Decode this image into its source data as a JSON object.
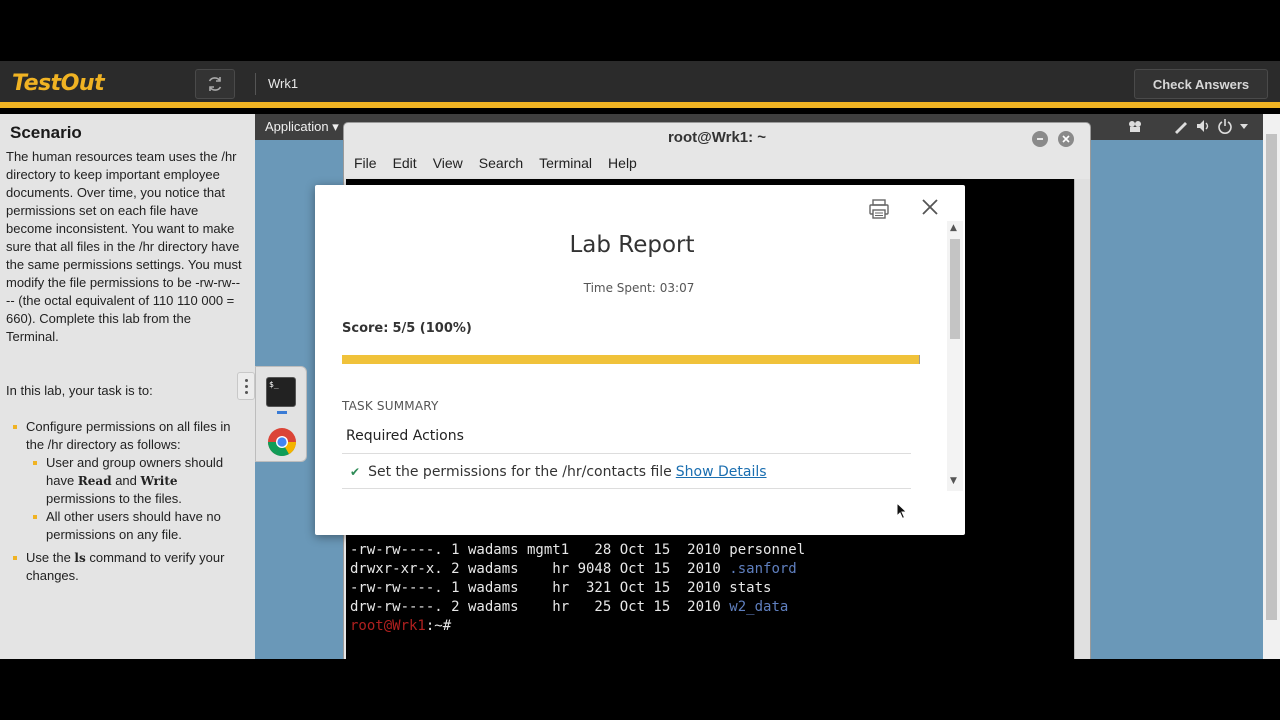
{
  "app": {
    "logo": "TestOut",
    "machine": "Wrk1",
    "check_answers": "Check Answers"
  },
  "scenario": {
    "title": "Scenario",
    "paragraph": "The human resources team uses the /hr directory to keep important employee documents. Over time, you notice that permissions set on each file have become inconsistent. You want to make sure that all files in the /hr directory have the same permissions settings. You must modify the file permissions to be -rw-rw---- (the octal equivalent of 110 110 000 = 660). Complete this lab from the Terminal.",
    "task_intro": "In this lab, your task is to:",
    "task1": "Configure permissions on all files in the /hr directory as follows:",
    "sub1_pre": "User and group owners should have ",
    "sub1_read": "Read",
    "sub1_and": " and ",
    "sub1_write": "Write",
    "sub1_post": " permissions to the files.",
    "sub2": "All other users should have no permissions on any file.",
    "task2_pre": "Use the ",
    "task2_cmd": "ls",
    "task2_post": " command to verify your changes."
  },
  "desktop": {
    "app_menu": "Application ▾",
    "terminal_title": "root@Wrk1: ~",
    "menu": [
      "File",
      "Edit",
      "View",
      "Search",
      "Terminal",
      "Help"
    ],
    "dock_terminal_glyph": "$_",
    "lines": [
      {
        "perm": "-rw-rw----.",
        "n": "1",
        "user": "wadams",
        "group": "mgmt1",
        "size": "28",
        "mon": "Oct",
        "day": "15",
        "year": "2010",
        "name": "personnel",
        "is_dir": false
      },
      {
        "perm": "drwxr-xr-x.",
        "n": "2",
        "user": "wadams",
        "group": "hr",
        "size": "9048",
        "mon": "Oct",
        "day": "15",
        "year": "2010",
        "name": ".sanford",
        "is_dir": true
      },
      {
        "perm": "-rw-rw----.",
        "n": "1",
        "user": "wadams",
        "group": "hr",
        "size": "321",
        "mon": "Oct",
        "day": "15",
        "year": "2010",
        "name": "stats",
        "is_dir": false
      },
      {
        "perm": "drw-rw----.",
        "n": "2",
        "user": "wadams",
        "group": "hr",
        "size": "25",
        "mon": "Oct",
        "day": "15",
        "year": "2010",
        "name": "w2_data",
        "is_dir": true
      }
    ],
    "prompt_user": "root@Wrk1",
    "prompt_rest": ":~#"
  },
  "modal": {
    "title": "Lab Report",
    "time_label": "Time Spent:",
    "time_value": "03:07",
    "score_label": "Score:",
    "score_value": "5/5 (100%)",
    "progress": 1.0,
    "task_summary": "TASK SUMMARY",
    "required_actions": "Required Actions",
    "task_text": "Set the permissions for the /hr/contacts file",
    "show_details": "Show Details"
  },
  "colors": {
    "accent": "#f0b323",
    "progress": "#f0c23a",
    "link": "#1a6eb0",
    "check": "#2e8b57"
  }
}
